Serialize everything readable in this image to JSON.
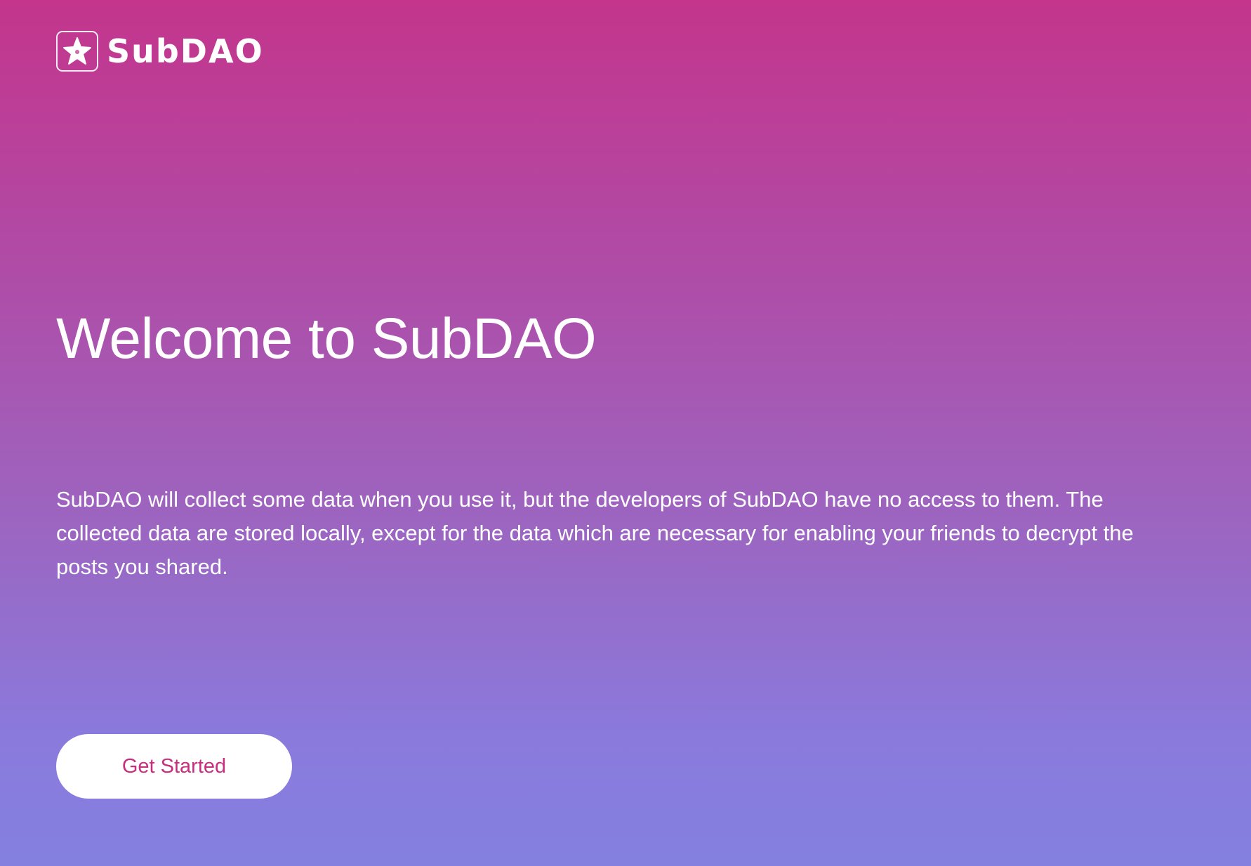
{
  "brand": {
    "name": "SubDAO",
    "logo_icon": "star-icon"
  },
  "main": {
    "title": "Welcome to SubDAO",
    "description": "SubDAO will collect some data when you use it, but the developers of SubDAO have no access to them. The collected data are stored locally, except for the data which are necessary for enabling your friends to decrypt the posts you shared."
  },
  "actions": {
    "get_started_label": "Get Started"
  },
  "colors": {
    "gradient_top": "#c4358c",
    "gradient_bottom": "#8480e0",
    "button_text": "#c72f7c",
    "button_background": "#ffffff"
  }
}
